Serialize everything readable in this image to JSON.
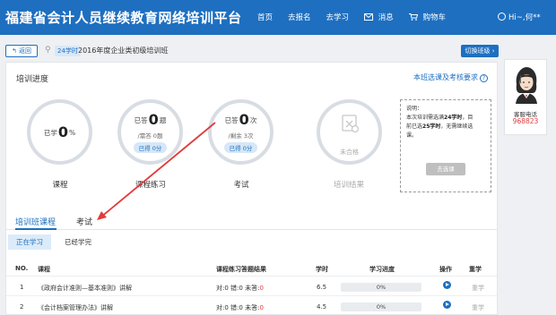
{
  "header": {
    "brand": "福建省会计人员继续教育网络培训平台",
    "nav": [
      "首页",
      "去报名",
      "去学习"
    ],
    "messages": "消息",
    "cart": "购物车",
    "user": "Hi~,何**"
  },
  "course": {
    "back": "返回",
    "hours_badge": "24学时",
    "title": "2016年度企业类初级培训班",
    "switch": "切换班级"
  },
  "progress": {
    "title": "培训进度",
    "requirement_link": "本班选课及考核要求",
    "course": {
      "prefix": "已学",
      "value": "0",
      "unit": "%",
      "label": "课程"
    },
    "practice": {
      "prefix": "已答",
      "value": "0",
      "unit": "题",
      "sub": "/需答 0题",
      "pill": "已得 0分",
      "label": "课程练习"
    },
    "exam": {
      "prefix": "已答",
      "value": "0",
      "unit": "次",
      "sub": "/剩余 3次",
      "pill": "已得 0分",
      "label": "考试"
    },
    "result": {
      "text": "未合格",
      "label": "培训结果"
    }
  },
  "notice": {
    "line1": "说明：",
    "line2a": "本次培训需选满",
    "line2b": "24学时",
    "line2c": "，目",
    "line3a": "前已选",
    "line3b": "25学时",
    "line3c": "，无需继续选",
    "line4": "课。",
    "button": "去选课"
  },
  "tabs": [
    "培训班课程",
    "考试"
  ],
  "subtabs": [
    "正在学习",
    "已经学完"
  ],
  "table": {
    "headers": [
      "NO.",
      "课程",
      "课程练习答题结果",
      "学时",
      "学习进度",
      "操作",
      "重学"
    ],
    "rows": [
      {
        "no": "1",
        "name": "《政府会计准则—基本准则》讲解",
        "right": "对:0",
        "wrong": "错:0",
        "pending_label": "未答:",
        "pending": "0",
        "hours": "6.5",
        "progress": "0%",
        "progress_value": 0,
        "redo": "重学"
      },
      {
        "no": "2",
        "name": "《会计档案管理办法》讲解",
        "right": "对:0",
        "wrong": "错:0",
        "pending_label": "未答:",
        "pending": "0",
        "hours": "4.5",
        "progress": "0%",
        "progress_value": 0,
        "redo": "重学"
      }
    ]
  },
  "service": {
    "label": "客服电话",
    "number": "968823"
  },
  "colors": {
    "primary": "#1e6fc0",
    "accent_red": "#e23b3b",
    "annotation": "#e23b3b"
  }
}
